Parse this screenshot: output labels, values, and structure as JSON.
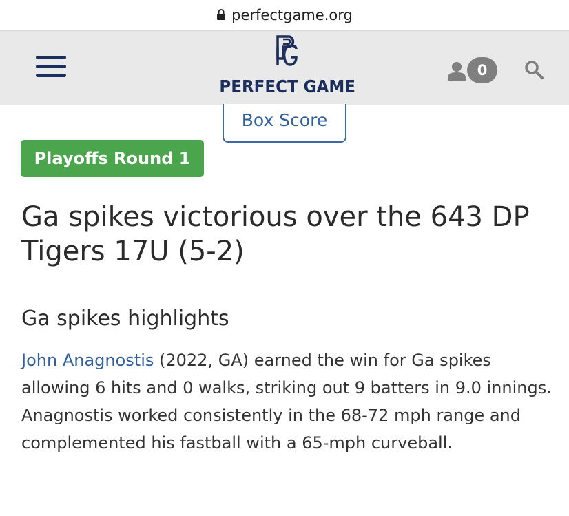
{
  "browser": {
    "url": "perfectgame.org"
  },
  "header": {
    "brand": "PERFECT GAME",
    "logo_monogram": "PG",
    "cart_count": "0"
  },
  "tabs": {
    "box_score": "Box Score"
  },
  "article": {
    "badge": "Playoffs Round 1",
    "headline": "Ga spikes victorious over the 643 DP Tigers 17U (5-2)",
    "subhead": "Ga spikes highlights",
    "player_link": "John Anagnostis",
    "body_text": " (2022, GA) earned the win for Ga spikes allowing 6 hits and 0 walks, striking out 9 batters in 9.0 innings. Anagnostis worked consistently in the 68-72 mph range and complemented his fastball with a 65-mph curveball."
  },
  "colors": {
    "brand_navy": "#1c2e5b",
    "link_blue": "#2f5f9e",
    "badge_green": "#4aa54c",
    "header_bg": "#e9e9e9",
    "icon_gray": "#7f7f7f"
  },
  "icons": {
    "lock": "lock-icon",
    "menu": "hamburger-menu-icon",
    "user": "user-icon",
    "search": "search-icon"
  }
}
